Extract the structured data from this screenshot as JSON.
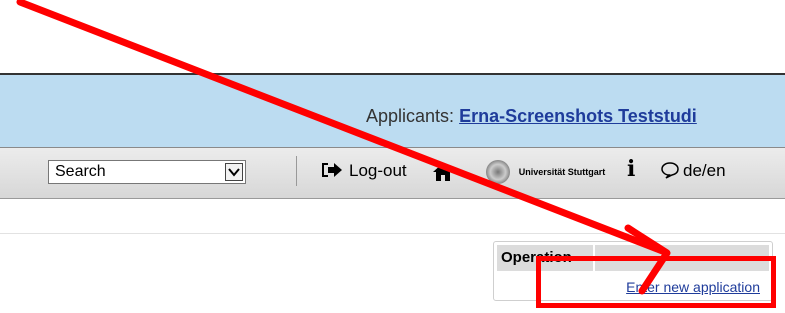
{
  "header": {
    "applicants_label": "Applicants:",
    "applicant_name": "Erna-Screenshots Teststudi"
  },
  "toolbar": {
    "search_select_value": "Search",
    "logout_label": "Log-out",
    "university_label": "Universität Stuttgart",
    "info_label": "i",
    "language_label": "de/en"
  },
  "operations": {
    "column_header": "Operation",
    "enter_new_application_link": "Enter new application"
  },
  "annotation": {
    "color": "#ff0000"
  }
}
